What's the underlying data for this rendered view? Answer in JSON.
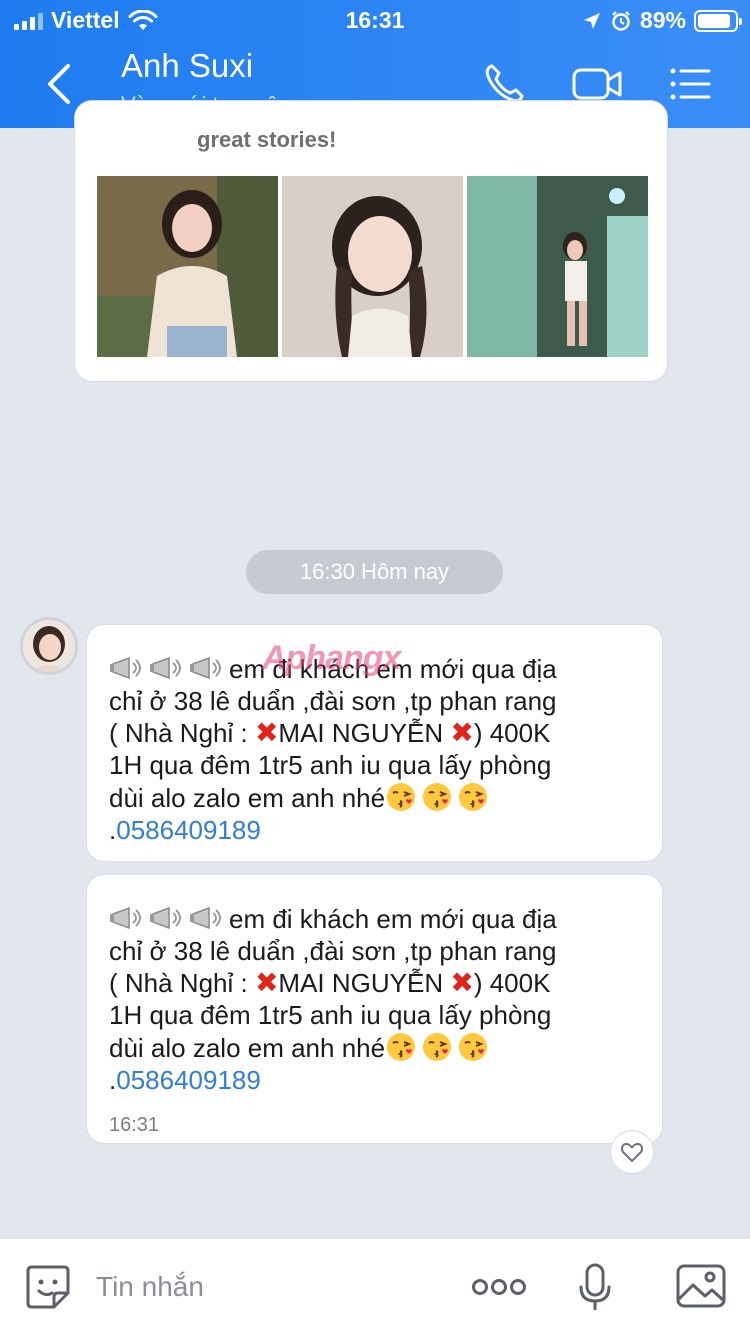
{
  "status_bar": {
    "carrier": "Viettel",
    "time": "16:31",
    "battery": "89%",
    "battery_level": 0.89
  },
  "header": {
    "contact_name": "Anh Suxi",
    "contact_status": "Vừa mới truy cập"
  },
  "story_card": {
    "text": "great stories!"
  },
  "divider": {
    "label": "16:30 Hôm nay"
  },
  "messages": [
    {
      "line1": "em đi khách em mới qua địa",
      "line2": "chỉ  ở 38 lê duẩn ,đài sơn ,tp phan rang",
      "line3_a": "( Nhà Nghỉ : ",
      "line3_b": "MAI NGUYỄN ",
      "line3_c": ") 400K",
      "line4": "1H qua đêm 1tr5   anh iu qua lấy phòng",
      "line5": "dùi alo zalo  em anh nhé",
      "phone_prefix": ".",
      "phone": "0586409189",
      "watermark": "Aphangx"
    },
    {
      "line1": "em đi khách em mới qua địa",
      "line2": "chỉ  ở 38 lê duẩn ,đài sơn ,tp phan rang",
      "line3_a": "( Nhà Nghỉ : ",
      "line3_b": "MAI NGUYỄN ",
      "line3_c": ") 400K",
      "line4": "1H qua đêm 1tr5   anh iu qua lấy phòng",
      "line5": "dùi alo zalo  em anh nhé",
      "phone_prefix": ".",
      "phone": "0586409189",
      "time": "16:31"
    }
  ],
  "input_bar": {
    "placeholder": "Tin nhắn"
  },
  "icons": {
    "back": "chevron-left-icon",
    "call": "phone-icon",
    "video": "video-camera-icon",
    "menu": "list-menu-icon",
    "sticker": "emoji-sticker-icon",
    "more": "more-dots-icon",
    "mic": "microphone-icon",
    "image": "image-icon",
    "react": "heart-icon",
    "megaphone": "megaphone-icon",
    "kiss": "kiss-emoji-icon",
    "cross": "cross-mark-icon"
  },
  "colors": {
    "header": "#1e7cf0",
    "link": "#2f7fd9",
    "cross": "#e0241b"
  }
}
